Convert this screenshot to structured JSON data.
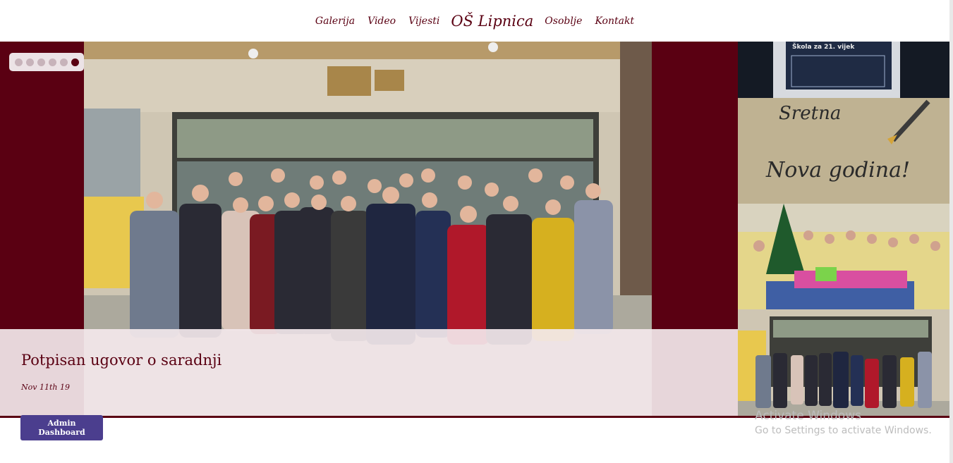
{
  "nav": {
    "galerija": "Galerija",
    "video": "Video",
    "vijesti": "Vijesti",
    "brand": "OŠ Lipnica",
    "osoblje": "Osoblje",
    "kontakt": "Kontakt"
  },
  "slider": {
    "dot_count": 6,
    "active_index": 5,
    "caption_title": "Potpisan ugovor o saradnji",
    "caption_date": "Nov 11th 19"
  },
  "thumbnails": {
    "screen_text": "Škola za 21. vijek",
    "card_line1": "Sretna",
    "card_line2": "Nova godina!"
  },
  "admin": {
    "label": "Admin Dashboard"
  },
  "windows_notice": {
    "title": "Activate Windows",
    "subtitle": "Go to Settings to activate Windows."
  },
  "colors": {
    "brand": "#5a0012",
    "admin_button": "#4b3e8e",
    "caption_bg": "#f3e8ec"
  }
}
